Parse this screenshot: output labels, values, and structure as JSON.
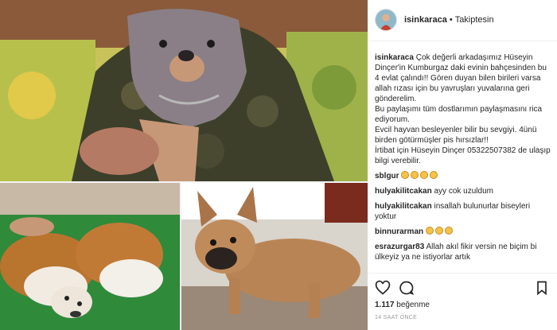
{
  "header": {
    "username": "isinkaraca",
    "separator": "•",
    "follow_status": "Takiptesin"
  },
  "caption": {
    "username": "isinkaraca",
    "line1": "Çok değerli arkadaşımız Hüseyin Dinçer'in Kumburgaz daki evinin bahçesinden bu 4 evlat çalındı!! Gören duyan bilen birileri varsa allah rızası için bu yavruşları yuvalarına geri gönderelim.",
    "line2": "Bu paylaşımı tüm dostlarımın paylaşmasını rica ediyorum.",
    "line3": "Evcil hayvan besleyenler bilir bu sevgiyi. 4ünü birden götürmüşler pis hırsızlar!!",
    "line4": "İrtibat için Hüseyin Dinçer 05322507382 de ulaşıp bilgi verebilir."
  },
  "comments": [
    {
      "username": "sblgur",
      "text": "",
      "emoji_count": 4
    },
    {
      "username": "hulyakilitcakan",
      "text": "ayy cok uzuldum",
      "emoji_count": 0
    },
    {
      "username": "hulyakilitcakan",
      "text": "insallah bulunurlar biseyleri yoktur",
      "emoji_count": 0
    },
    {
      "username": "binnurarman",
      "text": "",
      "emoji_count": 3
    },
    {
      "username": "esrazurgar83",
      "text": "Allah akıl fikir versin ne biçim bi ülkeyiz ya ne istiyorlar artık",
      "emoji_count": 0
    }
  ],
  "actions": {
    "likes_count": "1.117",
    "likes_word": "beğenme",
    "timestamp": "14 SAAT ÖNCE",
    "icons": [
      "heart-icon",
      "comment-icon",
      "bookmark-icon"
    ]
  },
  "colors": {
    "text": "#262626",
    "muted": "#999999",
    "divider": "#efefef",
    "emoji": "#f5c24a"
  }
}
